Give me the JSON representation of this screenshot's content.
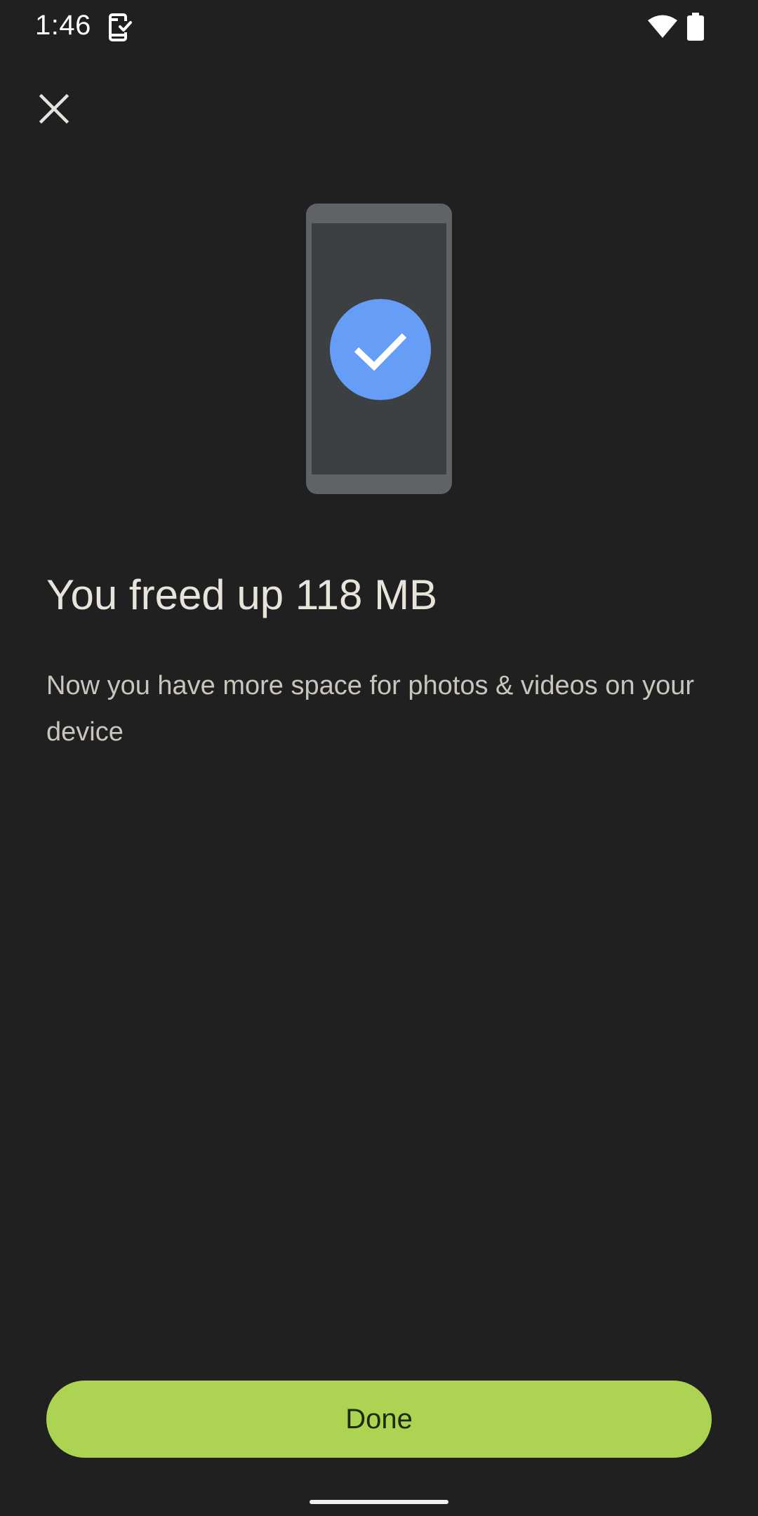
{
  "status_bar": {
    "time": "1:46",
    "icons": [
      "device-check-icon",
      "wifi-icon",
      "battery-icon"
    ]
  },
  "toolbar": {
    "close_icon": "close-icon"
  },
  "illustration": {
    "icon": "phone-check-illustration",
    "colors": {
      "phone_frame": "#5f6368",
      "phone_screen": "#3c4043",
      "check_circle": "#669df6",
      "check_mark": "#ffffff"
    }
  },
  "content": {
    "title": "You freed up 118 MB",
    "subtitle": "Now you have more space for photos & videos on your device"
  },
  "actions": {
    "done_label": "Done",
    "done_color": "#acd452"
  },
  "theme": {
    "background": "#202020",
    "text_primary": "#e8e4dc",
    "text_secondary": "#c9c5bc"
  }
}
